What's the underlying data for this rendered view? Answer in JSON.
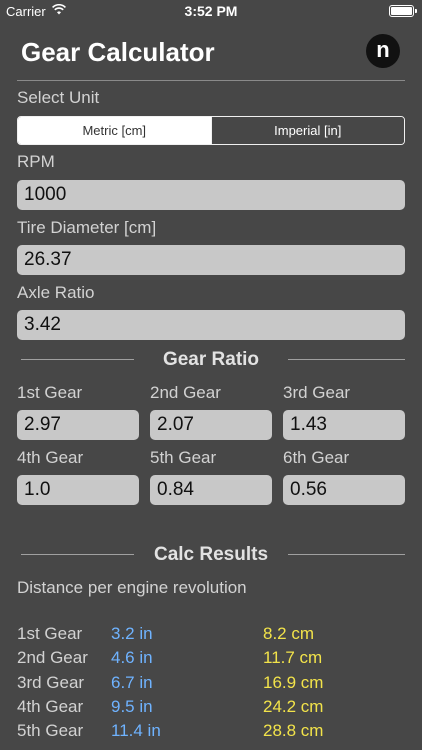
{
  "status": {
    "carrier": "Carrier",
    "time": "3:52 PM"
  },
  "header": {
    "title": "Gear Calculator",
    "logo": "n"
  },
  "unit": {
    "label": "Select Unit",
    "options": [
      "Metric [cm]",
      "Imperial [in]"
    ],
    "selected": "Metric [cm]"
  },
  "rpm": {
    "label": "RPM",
    "value": "1000"
  },
  "tire": {
    "label": "Tire Diameter [cm]",
    "value": "26.37"
  },
  "axle": {
    "label": "Axle Ratio",
    "value": "3.42"
  },
  "gear_ratio": {
    "title": "Gear Ratio",
    "gears": [
      {
        "label": "1st Gear",
        "value": "2.97"
      },
      {
        "label": "2nd Gear",
        "value": "2.07"
      },
      {
        "label": "3rd Gear",
        "value": "1.43"
      },
      {
        "label": "4th Gear",
        "value": "1.0"
      },
      {
        "label": "5th Gear",
        "value": "0.84"
      },
      {
        "label": "6th Gear",
        "value": "0.56"
      }
    ]
  },
  "results": {
    "title": "Calc Results",
    "subtitle": "Distance per engine revolution",
    "rows": [
      {
        "gear": "1st Gear",
        "imperial": "3.2 in",
        "metric": "8.2 cm"
      },
      {
        "gear": "2nd Gear",
        "imperial": "4.6 in",
        "metric": "11.7 cm"
      },
      {
        "gear": "3rd Gear",
        "imperial": "6.7 in",
        "metric": "16.9 cm"
      },
      {
        "gear": "4th Gear",
        "imperial": "9.5 in",
        "metric": "24.2 cm"
      },
      {
        "gear": "5th Gear",
        "imperial": "11.4 in",
        "metric": "28.8 cm"
      }
    ]
  },
  "colors": {
    "background": "#474747",
    "imperial_value": "#6fb3ff",
    "metric_value": "#f2e34a"
  }
}
